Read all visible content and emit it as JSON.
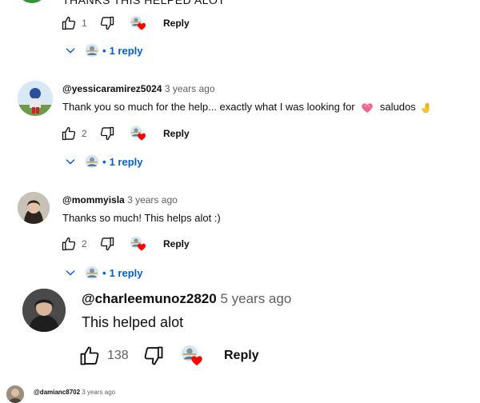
{
  "cut_comment": {
    "text_fragment": "THANKS THIS HELPED ALOT",
    "like_count": "1",
    "reply_label": "Reply",
    "replies_label": "1 reply"
  },
  "comments": [
    {
      "author": "@yessicaramirez5024",
      "age": "3 years ago",
      "text": "Thank you so much for the help... exactly what I was looking for",
      "text_tail": "saludos",
      "like_count": "2",
      "reply_label": "Reply",
      "replies_label": "1 reply"
    },
    {
      "author": "@mommyisla",
      "age": "3 years ago",
      "text": "Thanks so much! This helps alot :)",
      "like_count": "2",
      "reply_label": "Reply",
      "replies_label": "1 reply"
    },
    {
      "author": "@charleemunoz2820",
      "age": "5 years ago",
      "text": "This helped alot",
      "like_count": "138",
      "reply_label": "Reply"
    },
    {
      "author": "@damianc8702",
      "age": "3 years ago"
    }
  ],
  "icons": {
    "like": "thumbs-up-icon",
    "dislike": "thumbs-down-icon",
    "heart": "creator-heart-icon",
    "expand": "chevron-down-icon"
  },
  "colors": {
    "link_blue": "#065fd4",
    "heart_red": "#ff0000",
    "meta_gray": "#606060"
  }
}
